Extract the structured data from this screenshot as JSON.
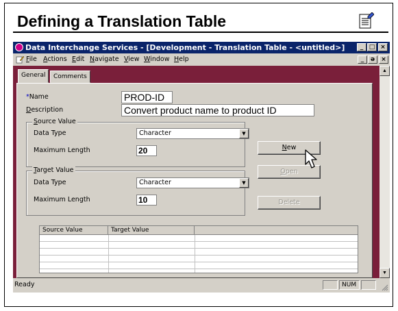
{
  "slide": {
    "title": "Defining a Translation Table"
  },
  "window": {
    "title": "Data Interchange Services - [Development - Translation Table - <untitled>]",
    "caption_buttons": {
      "minimize": "_",
      "maximize": "□",
      "close": "×"
    },
    "mdi_buttons": {
      "minimize": "_",
      "restore": "ǝ",
      "close": "×"
    }
  },
  "menu": {
    "items": [
      "File",
      "Actions",
      "Edit",
      "Navigate",
      "View",
      "Window",
      "Help"
    ]
  },
  "tabs": [
    "General",
    "Comments"
  ],
  "form": {
    "name_label": "Name",
    "required_marker": "*",
    "name_value": "PROD-ID",
    "description_label": "Description",
    "description_value": "Convert product name to product ID",
    "source": {
      "label": "Source Value",
      "data_type_label": "Data Type",
      "data_type_value": "Character",
      "max_length_label": "Maximum Length",
      "max_length_value": "20"
    },
    "target": {
      "label": "Target Value",
      "data_type_label": "Data Type",
      "data_type_value": "Character",
      "max_length_label": "Maximum Length",
      "max_length_value": "10"
    }
  },
  "buttons": {
    "new": "New",
    "open": "Open",
    "delete": "Delete"
  },
  "table": {
    "columns": [
      "Source Value",
      "Target Value",
      ""
    ]
  },
  "status": {
    "text": "Ready",
    "num": "NUM"
  },
  "colors": {
    "titlebar": "#0a246a",
    "workspace": "#7a1f3a",
    "face": "#d4d0c8"
  }
}
